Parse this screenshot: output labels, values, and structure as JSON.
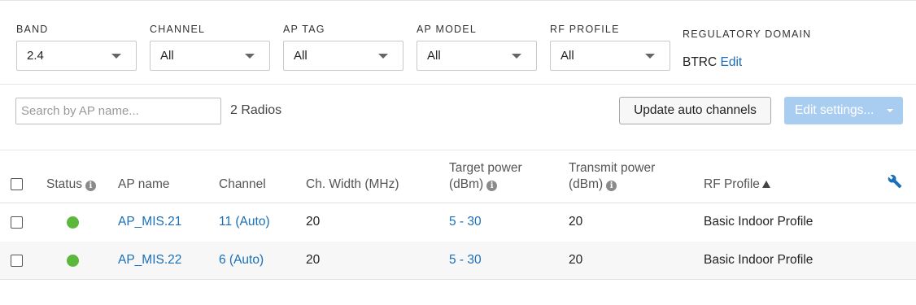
{
  "filters": {
    "band": {
      "label": "BAND",
      "value": "2.4"
    },
    "channel": {
      "label": "CHANNEL",
      "value": "All"
    },
    "ap_tag": {
      "label": "AP TAG",
      "value": "All"
    },
    "ap_model": {
      "label": "AP MODEL",
      "value": "All"
    },
    "rf_profile": {
      "label": "RF PROFILE",
      "value": "All"
    }
  },
  "regulatory": {
    "label": "REGULATORY DOMAIN",
    "value": "BTRC",
    "edit_label": "Edit"
  },
  "toolbar": {
    "search_placeholder": "Search by AP name...",
    "count_text": "2 Radios",
    "update_label": "Update auto channels",
    "edit_settings_label": "Edit settings..."
  },
  "table": {
    "headers": {
      "status": "Status",
      "ap_name": "AP name",
      "channel": "Channel",
      "ch_width": "Ch. Width (MHz)",
      "target_power_1": "Target power",
      "target_power_2": "(dBm)",
      "transmit_power_1": "Transmit power",
      "transmit_power_2": "(dBm)",
      "rf_profile": "RF Profile"
    },
    "rows": [
      {
        "status": "online",
        "ap_name": "AP_MIS.21",
        "channel": "11 (Auto)",
        "ch_width": "20",
        "target_power": "5 - 30",
        "transmit_power": "20",
        "rf_profile": "Basic Indoor Profile"
      },
      {
        "status": "online",
        "ap_name": "AP_MIS.22",
        "channel": "6 (Auto)",
        "ch_width": "20",
        "target_power": "5 - 30",
        "transmit_power": "20",
        "rf_profile": "Basic Indoor Profile"
      }
    ]
  },
  "colors": {
    "link": "#1a6fb8",
    "status_online": "#5cb83c",
    "primary_disabled": "#a9cdf0"
  },
  "icons": {
    "info": "info-icon",
    "sort": "sort-ascending-icon",
    "settings": "wrench-icon",
    "dropdown": "chevron-down-icon"
  }
}
